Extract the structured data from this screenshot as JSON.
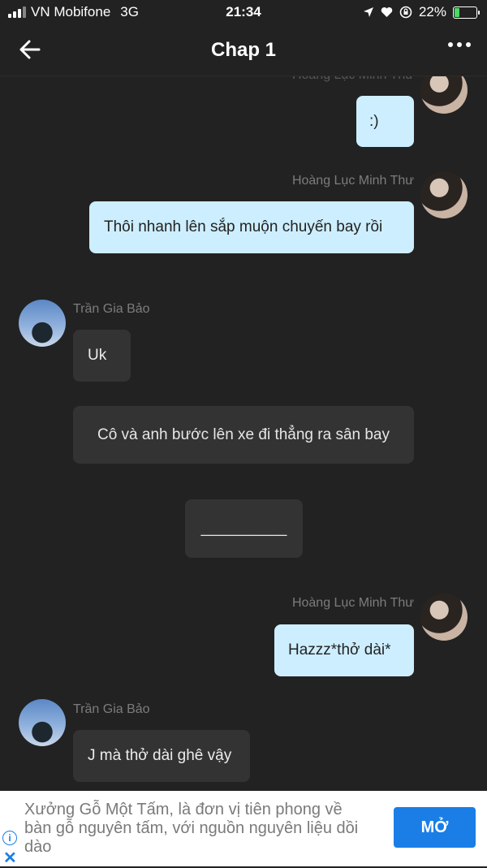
{
  "status": {
    "carrier": "VN Mobifone",
    "network": "3G",
    "time": "21:34",
    "battery": "22%",
    "icons": [
      "location-icon",
      "heart-icon",
      "lock-rotation-icon",
      "battery-charging-icon"
    ]
  },
  "header": {
    "title": "Chap 1",
    "back_icon": "arrow-left-icon",
    "more_icon": "more-horizontal-icon"
  },
  "messages": [
    {
      "name": "Hoàng Lục Minh Thư",
      "text": ":)"
    },
    {
      "name": "Hoàng Lục Minh Thư",
      "text": "Thôi nhanh lên sắp muộn chuyến bay rồi"
    },
    {
      "name": "Trần Gia Bảo",
      "text": "Uk"
    },
    {
      "text": "Cô và anh bước lên xe đi thẳng ra sân bay"
    },
    {
      "text": "__________"
    },
    {
      "name": "Hoàng Lục Minh Thư",
      "text": "Hazzz*thở dài*"
    },
    {
      "name": "Trần Gia Bảo",
      "text": "J mà thở dài ghê vậy"
    }
  ],
  "ad": {
    "text": "Xưởng Gỗ Một Tấm, là đơn vị tiên phong về bàn gỗ nguyên tấm, với nguồn nguyên liệu dồi dào",
    "button": "MỞ",
    "accent": "#1a7ee6"
  },
  "colors": {
    "background": "#222222",
    "my_bubble": "#cdeefe",
    "other_bubble": "#333333"
  }
}
